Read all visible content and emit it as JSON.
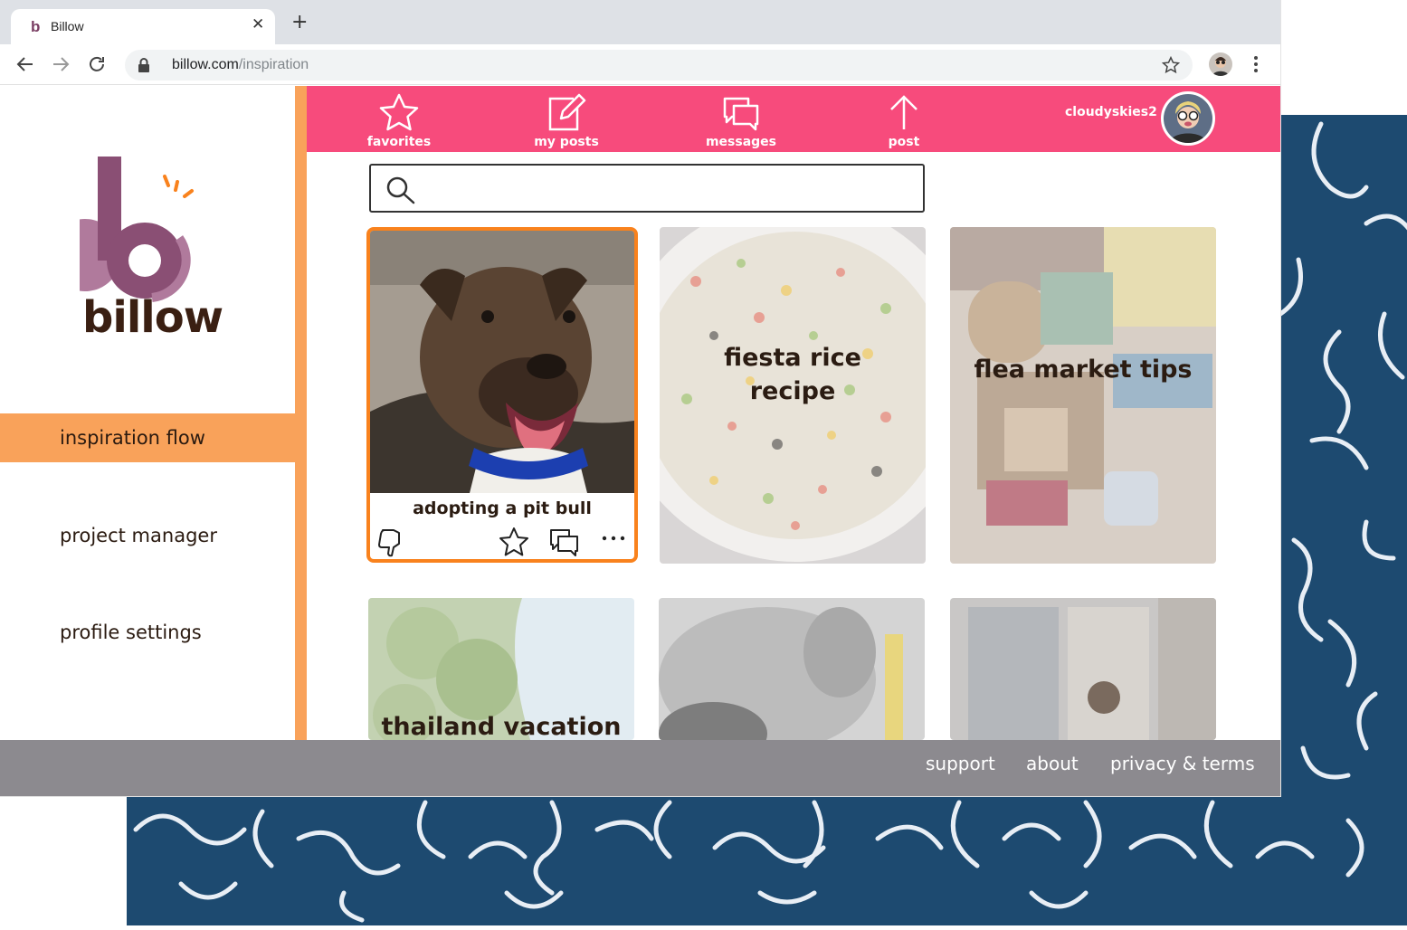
{
  "browser": {
    "tab_title": "Billow",
    "tab_favicon": "b",
    "url_host": "billow.com",
    "url_path": "/inspiration"
  },
  "brand": {
    "name": "billow",
    "colors": {
      "pink": "#f74b7c",
      "orange": "#f9a25a",
      "purple": "#8a4f74",
      "navy": "#1d4a70",
      "footer": "#8c8a8f"
    }
  },
  "sidebar": {
    "items": [
      {
        "label": "inspiration flow",
        "active": true
      },
      {
        "label": "project manager",
        "active": false
      },
      {
        "label": "profile settings",
        "active": false
      }
    ]
  },
  "topnav": {
    "items": [
      {
        "label": "favorites",
        "icon": "star-icon"
      },
      {
        "label": "my posts",
        "icon": "edit-icon"
      },
      {
        "label": "messages",
        "icon": "chat-icon"
      },
      {
        "label": "post",
        "icon": "arrow-up-icon"
      }
    ],
    "username": "cloudyskies2"
  },
  "search": {
    "placeholder": "",
    "value": ""
  },
  "cards": [
    {
      "title": "adopting a pit bull",
      "selected": true,
      "actions": [
        "thumbs-down-icon",
        "star-icon",
        "chat-icon",
        "more-icon"
      ]
    },
    {
      "title": "fiesta rice recipe"
    },
    {
      "title": "flea market tips"
    },
    {
      "title": "thailand vacation"
    },
    {
      "title": ""
    },
    {
      "title": ""
    }
  ],
  "footer": {
    "links": [
      "support",
      "about",
      "privacy & terms"
    ]
  }
}
